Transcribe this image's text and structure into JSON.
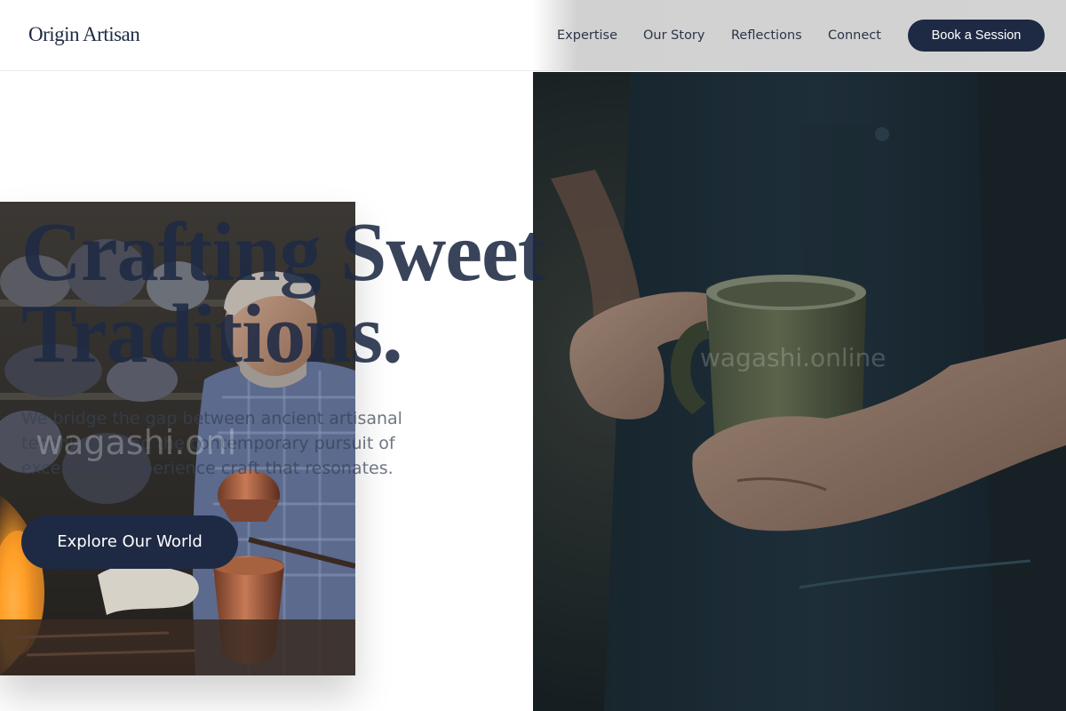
{
  "header": {
    "logo": "Origin Artisan",
    "nav": [
      {
        "label": "Expertise"
      },
      {
        "label": "Our Story"
      },
      {
        "label": "Reflections"
      },
      {
        "label": "Connect"
      }
    ],
    "cta_label": "Book a Session"
  },
  "hero": {
    "title_line1": "Crafting Sweet",
    "title_line2": "Traditions.",
    "description": "We bridge the gap between ancient artisanal techniques and the contemporary pursuit of excellence. Experience craft that resonates.",
    "cta_label": "Explore Our World"
  },
  "watermarks": {
    "left": "wagashi.onl",
    "right": "wagashi.online"
  },
  "images": {
    "left": "photo-artisan-copper-coffee-pot",
    "right": "photo-hands-holding-ceramic-mug"
  },
  "colors": {
    "primary": "#1e2a44",
    "header_bg": "#ffffff",
    "button_text": "#ffffff"
  }
}
